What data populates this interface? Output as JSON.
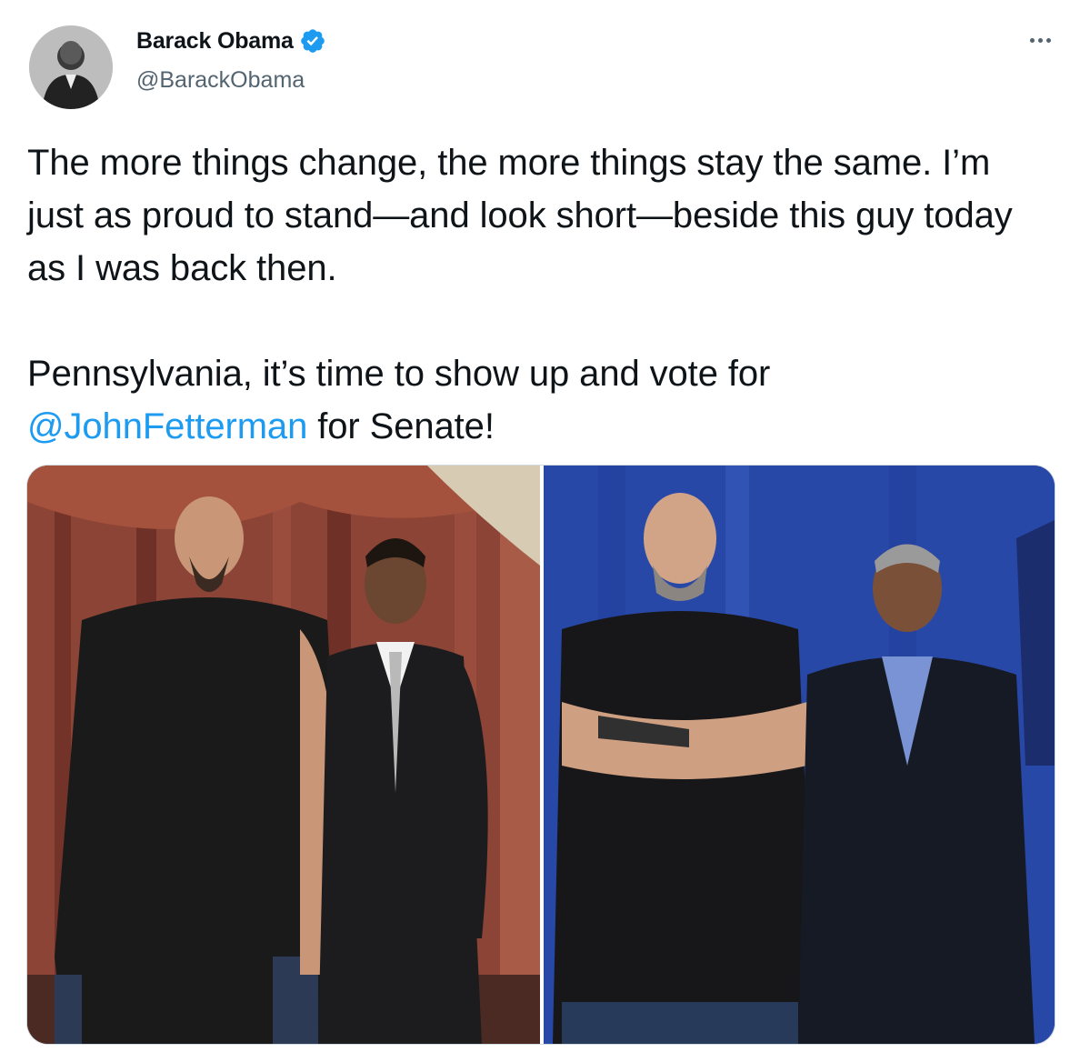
{
  "author": {
    "display_name": "Barack Obama",
    "handle": "@BarackObama",
    "verified": true,
    "avatar_icon": "profile-photo"
  },
  "tweet": {
    "line1": "The more things change, the more things stay the same. I’m just as proud to stand—and look short—beside this guy today as I was back then.",
    "line2_before": "Pennsylvania, it’s time to show up and vote for ",
    "mention": "@JohnFetterman",
    "line2_after": " for Senate!"
  },
  "media": {
    "photos": [
      {
        "alt": "photo-then"
      },
      {
        "alt": "photo-now"
      }
    ]
  },
  "colors": {
    "accent": "#1d9bf0",
    "text": "#0f1419",
    "secondary": "#536471"
  },
  "icons": {
    "verified": "verified-badge-icon",
    "more": "more-options-icon"
  }
}
